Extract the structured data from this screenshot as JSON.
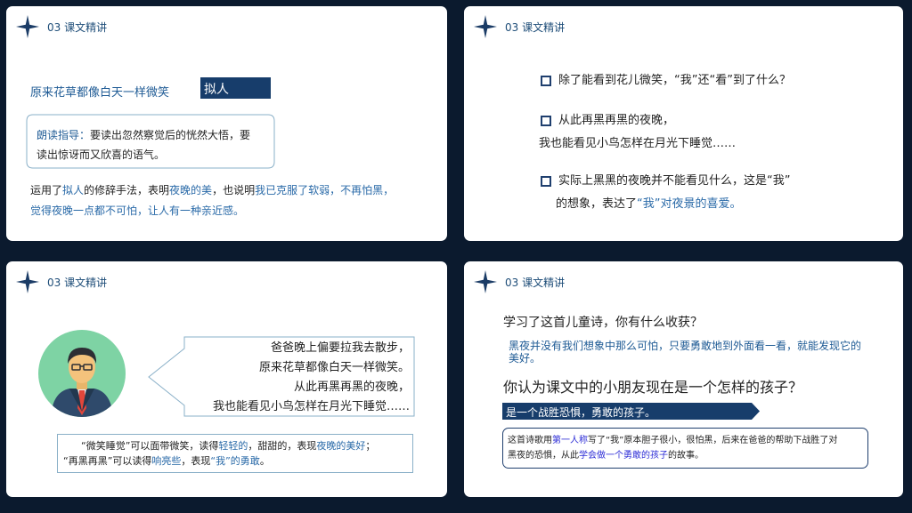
{
  "header": {
    "title": "03  课文精讲"
  },
  "slide1": {
    "sentence": "原来花草都像白天一样微笑",
    "tag": "拟人",
    "guide_label": "朗读指导：",
    "guide_text": "要读出忽然察觉后的恍然大悟，要",
    "guide_text2": "读出惊讶而又欣喜的语气。",
    "p_a": "运用了",
    "p_b": "拟人",
    "p_c": "的修辞手法，表明",
    "p_d": "夜晚的美",
    "p_e": "，也说明",
    "p_f": "我已克服了软弱，不再怕黑，",
    "p_g": "觉得夜晚一点都不可怕，让人有一种亲近感。"
  },
  "slide2": {
    "q1": "除了能看到花儿微笑，“我”还“看”到了什么？",
    "q2_line1": "从此再黑再黑的夜晚，",
    "q2_line2": "我也能看见小鸟怎样在月光下睡觉……",
    "q3_line1": "实际上黑黑的夜晚并不能看见什么，这是“我”",
    "q3_line2a": "的想象，表达了",
    "q3_line2b": "“我”对夜景的喜爱。"
  },
  "slide3": {
    "bubble": [
      "爸爸晚上偏要拉我去散步，",
      "原来花草都像白天一样微笑。",
      "从此再黑再黑的夜晚，",
      "我也能看见小鸟怎样在月光下睡觉……"
    ],
    "n_a": "“微笑睡觉”可以面带微笑，读得",
    "n_b": "轻轻的",
    "n_c": "，甜甜的，表现",
    "n_d": "夜晚的美好",
    "n_e": "；",
    "n_f": "“再黑再黑”可以读得",
    "n_g": "响亮些",
    "n_h": "，表现",
    "n_i": "“我”的勇敢",
    "n_j": "。"
  },
  "slide4": {
    "q1": "学习了这首儿童诗，你有什么收获？",
    "a1": "黑夜并没有我们想象中那么可怕，只要勇敢地到外面看一看，就能发现它的美好。",
    "q2": "你认为课文中的小朋友现在是一个怎样的孩子？",
    "banner": "是一个战胜恐惧，勇敢的孩子。",
    "box_a": "这首诗歌用",
    "box_b": "第一人称",
    "box_c": "写了“我”原本胆子很小，很怕黑，后来在爸爸的帮助下战胜了对",
    "box_d": "黑夜的恐惧，从此",
    "box_e": "学会做一个勇敢的孩子",
    "box_f": "的故事。"
  }
}
